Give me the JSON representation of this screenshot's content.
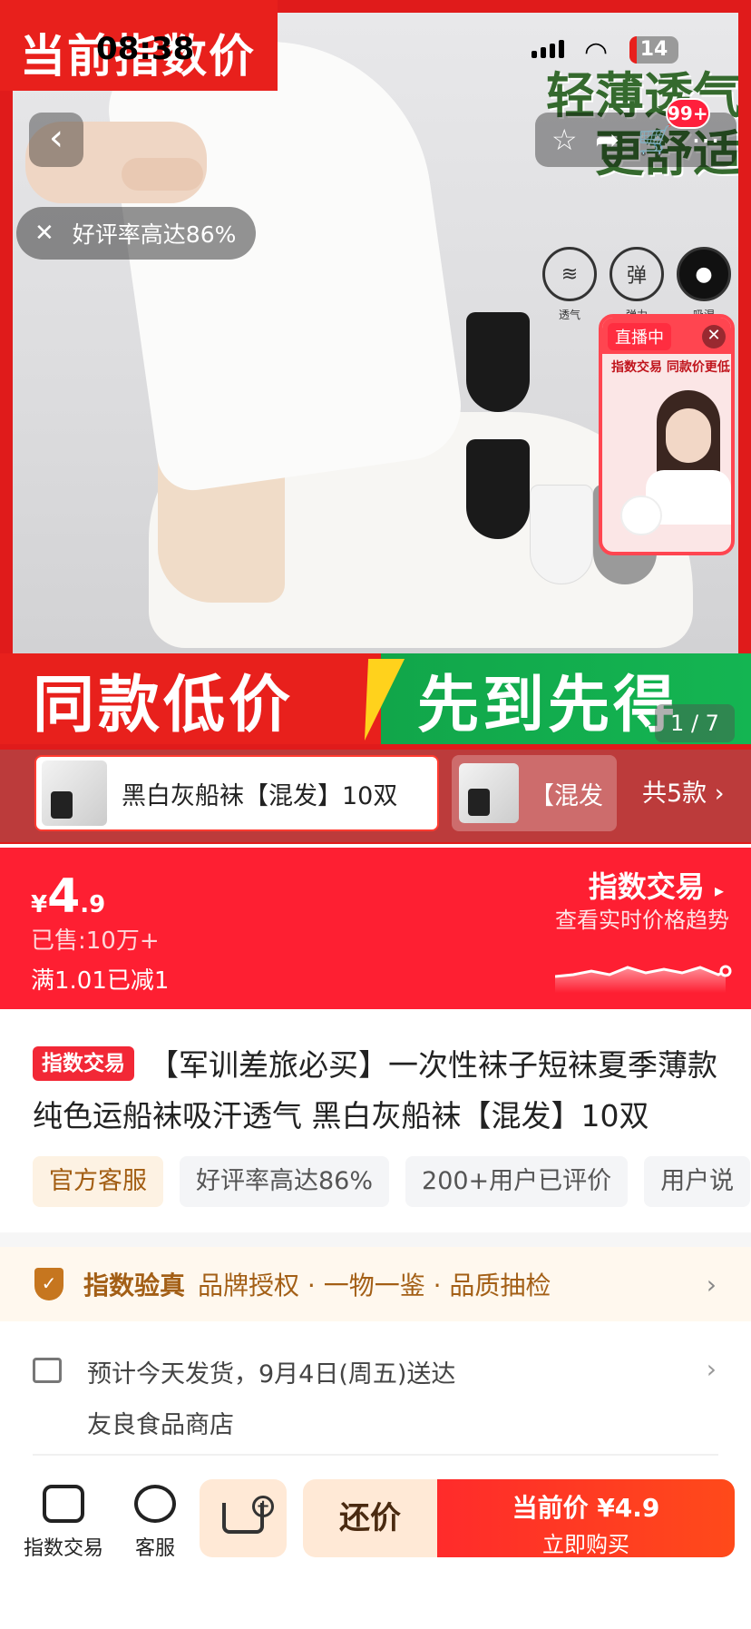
{
  "status_bar": {
    "time": "08:38",
    "battery": "14"
  },
  "hero": {
    "top_tag": "当前指数价",
    "slogan_line1": "轻薄透气",
    "slogan_line2": "更舒适",
    "features": [
      "透气",
      "弹力",
      "吸湿"
    ],
    "feature_glyphs": [
      "≋",
      "弹",
      "●"
    ],
    "banner_left": "同款低价",
    "banner_right": "先到先得",
    "cart_badge": "99+",
    "rating_toast": "好评率高达86%",
    "page_counter": "1 / 7"
  },
  "live": {
    "tag": "直播中",
    "title": "指数交易 同款价更低"
  },
  "variants": {
    "selected": "黑白灰船袜【混发】10双",
    "next": "【混发",
    "count_label": "共5款"
  },
  "price_bar": {
    "currency": "¥",
    "price_int": "4",
    "price_dec": ".9",
    "sold": "已售:10万+",
    "promo": "满1.01已减1",
    "index_title": "指数交易",
    "index_sub": "查看实时价格趋势"
  },
  "product": {
    "tag": "指数交易",
    "title": "【军训差旅必买】一次性袜子短袜夏季薄款纯色运船袜吸汗透气 黑白灰船袜【混发】10双",
    "chips": [
      "官方客服",
      "好评率高达86%",
      "200+用户已评价",
      "用户说"
    ]
  },
  "verify": {
    "title": "指数验真",
    "items": "品牌授权 · 一物一鉴 · 品质抽检"
  },
  "shipping": {
    "line": "预计今天发货，9月4日(周五)送达",
    "store": "友良食品商店"
  },
  "bottom_bar": {
    "index_label": "指数交易",
    "service_label": "客服",
    "bargain_label": "还价",
    "buy_price": "当前价 ¥4.9",
    "buy_label": "立即购买"
  },
  "colors": {
    "brand_red": "#fe1f32",
    "gold": "#a35f16",
    "green": "#11a64a"
  }
}
